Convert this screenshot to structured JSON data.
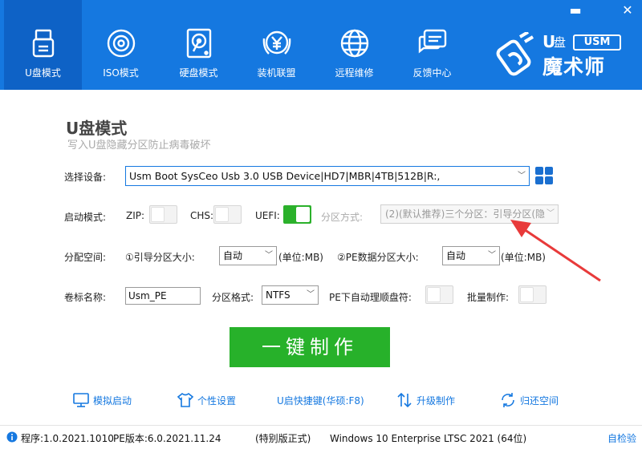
{
  "window": {
    "minimize_glyph": "▬",
    "close_glyph": "✕"
  },
  "nav": {
    "items": [
      {
        "label": "U盘模式",
        "icon": "usb-drive-icon",
        "active": true
      },
      {
        "label": "ISO模式",
        "icon": "disc-icon",
        "active": false
      },
      {
        "label": "硬盘模式",
        "icon": "hard-disk-icon",
        "active": false
      },
      {
        "label": "装机联盟",
        "icon": "yen-coin-icon",
        "active": false
      },
      {
        "label": "远程维修",
        "icon": "globe-icon",
        "active": false
      },
      {
        "label": "反馈中心",
        "icon": "chat-icon",
        "active": false
      }
    ]
  },
  "brand": {
    "u": "U",
    "pan": "盘",
    "badge": "USM",
    "name": "魔术师"
  },
  "main": {
    "title": "U盘模式",
    "subtitle": "写入U盘隐藏分区防止病毒破坏"
  },
  "device": {
    "label": "选择设备:",
    "value": "Usm Boot SysCeo Usb 3.0 USB Device|HD7|MBR|4TB|512B|R:,"
  },
  "boot": {
    "label": "启动模式:",
    "zip_label": "ZIP:",
    "zip_on": false,
    "chs_label": "CHS:",
    "chs_on": false,
    "uefi_label": "UEFI:",
    "uefi_on": true,
    "partition_mode_label": "分区方式:",
    "partition_mode_value": "(2)(默认推荐)三个分区：引导分区(隐"
  },
  "space": {
    "label": "分配空间:",
    "boot_size_label": "①引导分区大小:",
    "boot_size_value": "自动",
    "boot_unit": "(单位:MB)",
    "pe_size_label": "②PE数据分区大小:",
    "pe_size_value": "自动",
    "pe_unit": "(单位:MB)"
  },
  "volume": {
    "label": "卷标名称:",
    "value": "Usm_PE",
    "format_label": "分区格式:",
    "format_value": "NTFS",
    "pe_auto_label": "PE下自动理顺盘符:",
    "pe_auto_on": false,
    "batch_label": "批量制作:",
    "batch_on": false
  },
  "action": {
    "label": "一键制作"
  },
  "tools": [
    {
      "label": "模拟启动",
      "icon": "monitor-icon"
    },
    {
      "label": "个性设置",
      "icon": "shirt-icon"
    },
    {
      "label": "U启快捷键(华硕:F8)",
      "icon": "none"
    },
    {
      "label": "升级制作",
      "icon": "upgrade-arrows-icon"
    },
    {
      "label": "归还空间",
      "icon": "refresh-icon"
    }
  ],
  "status": {
    "program_version": "程序:1.0.2021.1010",
    "pe_version": "PE版本:6.0.2021.11.24",
    "edition": "(特别版正式)",
    "os": "Windows 10 Enterprise LTSC 2021 (64位)",
    "self_check": "自检验"
  },
  "colors": {
    "header": "#1578e0",
    "header_active": "#0e62c6",
    "accent_green": "#27b12a",
    "arrow_red": "#e83a3a",
    "link_blue": "#1578e0"
  }
}
